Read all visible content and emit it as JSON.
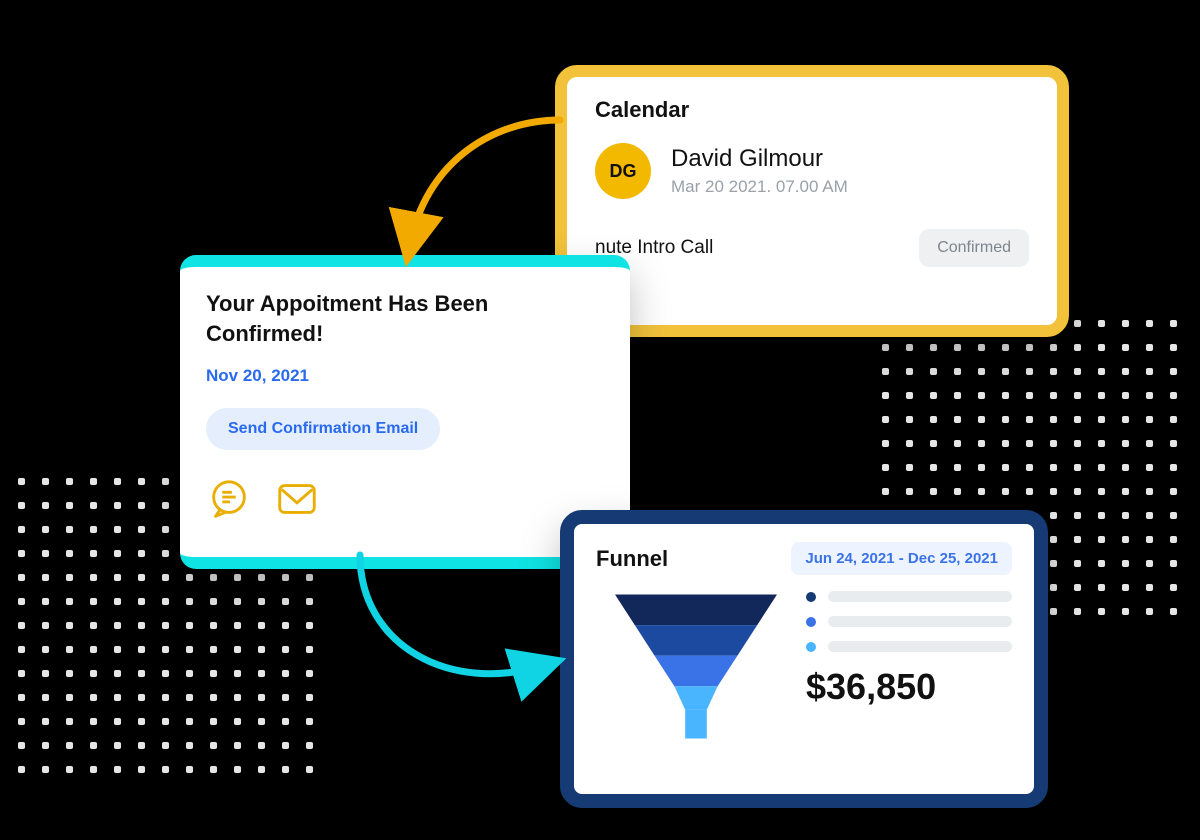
{
  "calendar": {
    "title": "Calendar",
    "avatar_initials": "DG",
    "name": "David Gilmour",
    "datetime": "Mar 20 2021. 07.00 AM",
    "event_partial": "nute Intro Call",
    "status": "Confirmed"
  },
  "appointment": {
    "title": "Your Appoitment Has Been Confirmed!",
    "date": "Nov 20, 2021",
    "button": "Send Confirmation Email"
  },
  "funnel": {
    "title": "Funnel",
    "date_range": "Jun 24, 2021 -  Dec 25, 2021",
    "amount": "$36,850",
    "legend_colors": [
      "#163a74",
      "#3a72e8",
      "#49b4ff"
    ]
  }
}
